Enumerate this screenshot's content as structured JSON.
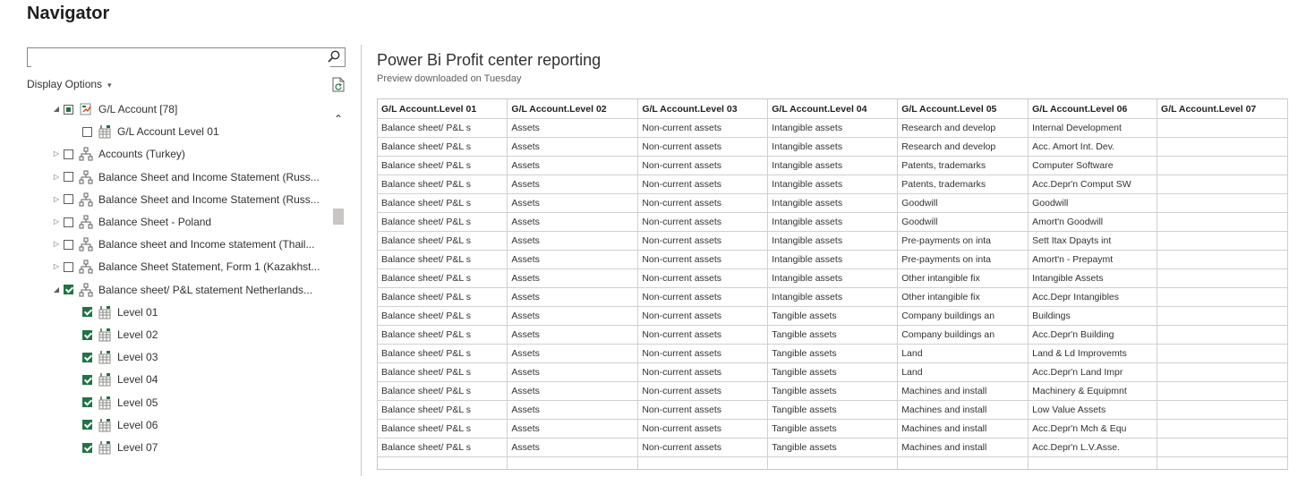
{
  "window": {
    "title": "Navigator"
  },
  "search": {
    "value": "",
    "placeholder": "",
    "icon": "search-icon"
  },
  "display_options": {
    "label": "Display Options",
    "caret": "▾"
  },
  "tree": [
    {
      "label": "G/L Account [78]",
      "expander": "◢",
      "check": "partial",
      "icon": "folder-icon",
      "indent": 1
    },
    {
      "label": "G/L Account Level 01",
      "expander": "",
      "check": "unchecked",
      "icon": "table-icon",
      "indent": 2
    },
    {
      "label": "Accounts (Turkey)",
      "expander": "▷",
      "check": "unchecked",
      "icon": "hierarchy-icon",
      "indent": 1
    },
    {
      "label": "Balance Sheet and Income Statement (Russ...",
      "expander": "▷",
      "check": "unchecked",
      "icon": "hierarchy-icon",
      "indent": 1
    },
    {
      "label": "Balance Sheet and Income Statement (Russ...",
      "expander": "▷",
      "check": "unchecked",
      "icon": "hierarchy-icon",
      "indent": 1
    },
    {
      "label": "Balance Sheet - Poland",
      "expander": "▷",
      "check": "unchecked",
      "icon": "hierarchy-icon",
      "indent": 1
    },
    {
      "label": "Balance sheet and Income statement (Thail...",
      "expander": "▷",
      "check": "unchecked",
      "icon": "hierarchy-icon",
      "indent": 1
    },
    {
      "label": "Balance Sheet Statement, Form 1 (Kazakhst...",
      "expander": "▷",
      "check": "unchecked",
      "icon": "hierarchy-icon",
      "indent": 1
    },
    {
      "label": "Balance sheet/ P&L statement Netherlands...",
      "expander": "◢",
      "check": "checked",
      "icon": "hierarchy-icon",
      "indent": 1
    },
    {
      "label": "Level 01",
      "expander": "",
      "check": "checked",
      "icon": "table-icon",
      "indent": 2
    },
    {
      "label": "Level 02",
      "expander": "",
      "check": "checked",
      "icon": "table-icon",
      "indent": 2
    },
    {
      "label": "Level 03",
      "expander": "",
      "check": "checked",
      "icon": "table-icon",
      "indent": 2
    },
    {
      "label": "Level 04",
      "expander": "",
      "check": "checked",
      "icon": "table-icon",
      "indent": 2
    },
    {
      "label": "Level 05",
      "expander": "",
      "check": "checked",
      "icon": "table-icon",
      "indent": 2
    },
    {
      "label": "Level 06",
      "expander": "",
      "check": "checked",
      "icon": "table-icon",
      "indent": 2
    },
    {
      "label": "Level 07",
      "expander": "",
      "check": "checked",
      "icon": "table-icon",
      "indent": 2
    }
  ],
  "preview": {
    "title": "Power Bi Profit center reporting",
    "subtitle": "Preview downloaded on Tuesday",
    "columns": [
      "G/L Account.Level 01",
      "G/L Account.Level 02",
      "G/L Account.Level 03",
      "G/L Account.Level 04",
      "G/L Account.Level 05",
      "G/L Account.Level 06",
      "G/L Account.Level 07"
    ],
    "rows": [
      [
        "Balance sheet/ P&L s",
        "Assets",
        "Non-current assets",
        "Intangible assets",
        "Research and develop",
        "Internal Development",
        ""
      ],
      [
        "Balance sheet/ P&L s",
        "Assets",
        "Non-current assets",
        "Intangible assets",
        "Research and develop",
        "Acc. Amort Int. Dev.",
        ""
      ],
      [
        "Balance sheet/ P&L s",
        "Assets",
        "Non-current assets",
        "Intangible assets",
        "Patents, trademarks",
        "Computer Software",
        ""
      ],
      [
        "Balance sheet/ P&L s",
        "Assets",
        "Non-current assets",
        "Intangible assets",
        "Patents, trademarks",
        "Acc.Depr'n Comput SW",
        ""
      ],
      [
        "Balance sheet/ P&L s",
        "Assets",
        "Non-current assets",
        "Intangible assets",
        "Goodwill",
        "Goodwill",
        ""
      ],
      [
        "Balance sheet/ P&L s",
        "Assets",
        "Non-current assets",
        "Intangible assets",
        "Goodwill",
        "Amort'n Goodwill",
        ""
      ],
      [
        "Balance sheet/ P&L s",
        "Assets",
        "Non-current assets",
        "Intangible assets",
        "Pre-payments on inta",
        "Sett Itax Dpayts int",
        ""
      ],
      [
        "Balance sheet/ P&L s",
        "Assets",
        "Non-current assets",
        "Intangible assets",
        "Pre-payments on inta",
        "Amort'n - Prepaymt",
        ""
      ],
      [
        "Balance sheet/ P&L s",
        "Assets",
        "Non-current assets",
        "Intangible assets",
        "Other intangible fix",
        "Intangible Assets",
        ""
      ],
      [
        "Balance sheet/ P&L s",
        "Assets",
        "Non-current assets",
        "Intangible assets",
        "Other intangible fix",
        "Acc.Depr Intangibles",
        ""
      ],
      [
        "Balance sheet/ P&L s",
        "Assets",
        "Non-current assets",
        "Tangible assets",
        "Company buildings an",
        "Buildings",
        ""
      ],
      [
        "Balance sheet/ P&L s",
        "Assets",
        "Non-current assets",
        "Tangible assets",
        "Company buildings an",
        "Acc.Depr'n Building",
        ""
      ],
      [
        "Balance sheet/ P&L s",
        "Assets",
        "Non-current assets",
        "Tangible assets",
        "Land",
        "Land & Ld Improvemts",
        ""
      ],
      [
        "Balance sheet/ P&L s",
        "Assets",
        "Non-current assets",
        "Tangible assets",
        "Land",
        "Acc.Depr'n Land Impr",
        ""
      ],
      [
        "Balance sheet/ P&L s",
        "Assets",
        "Non-current assets",
        "Tangible assets",
        "Machines and install",
        "Machinery & Equipmnt",
        ""
      ],
      [
        "Balance sheet/ P&L s",
        "Assets",
        "Non-current assets",
        "Tangible assets",
        "Machines and install",
        "Low Value Assets",
        ""
      ],
      [
        "Balance sheet/ P&L s",
        "Assets",
        "Non-current assets",
        "Tangible assets",
        "Machines and install",
        "Acc.Depr'n Mch & Equ",
        ""
      ],
      [
        "Balance sheet/ P&L s",
        "Assets",
        "Non-current assets",
        "Tangible assets",
        "Machines and install",
        "Acc.Depr'n L.V.Asse.",
        ""
      ]
    ]
  },
  "colors": {
    "accent": "#217346",
    "border": "#c8c6c4"
  }
}
